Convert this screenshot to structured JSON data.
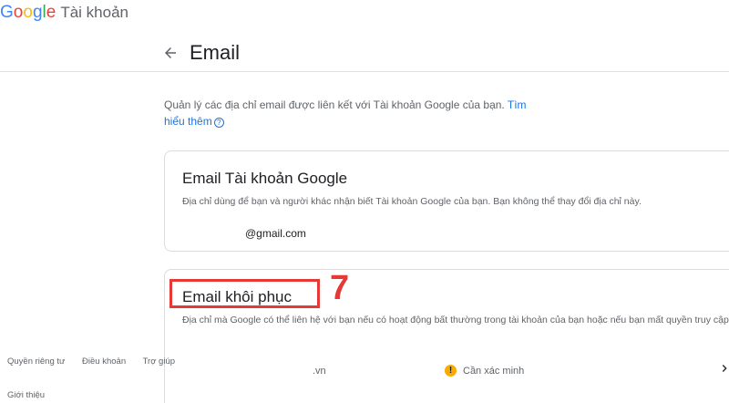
{
  "header": {
    "logo_g1": "G",
    "logo_o1": "o",
    "logo_o2": "o",
    "logo_g2": "g",
    "logo_l": "l",
    "logo_e": "e",
    "product": "Tài khoản"
  },
  "page": {
    "title": "Email",
    "intro_text": "Quản lý các địa chỉ email được liên kết với Tài khoản Google của bạn.",
    "learn_more": "Tìm hiểu thêm",
    "help_glyph": "?"
  },
  "account_email_card": {
    "title": "Email Tài khoản Google",
    "description": "Địa chỉ dùng để bạn và người khác nhận biết Tài khoản Google của bạn. Bạn không thể thay đổi địa chỉ này.",
    "email": "@gmail.com"
  },
  "recovery_email_card": {
    "title": "Email khôi phục",
    "description": "Địa chỉ mà Google có thể liên hệ với bạn nếu có hoạt động bất thường trong tài khoản của bạn hoặc nếu bạn mất quyền truy cập.",
    "email": ".vn",
    "status": "Cần xác minh",
    "warning_glyph": "!"
  },
  "annotation": {
    "step": "7",
    "color": "#e53935"
  },
  "footer": {
    "privacy": "Quyền riêng tư",
    "terms": "Điều khoản",
    "help": "Trợ giúp",
    "about": "Giới thiệu"
  },
  "colors": {
    "accent": "#1a73e8",
    "warning": "#f9ab00",
    "border": "#dadce0"
  },
  "icons": {
    "back": "arrow-left-icon",
    "help": "help-circle-icon",
    "warning": "warning-icon",
    "chevron": "chevron-right-icon"
  }
}
